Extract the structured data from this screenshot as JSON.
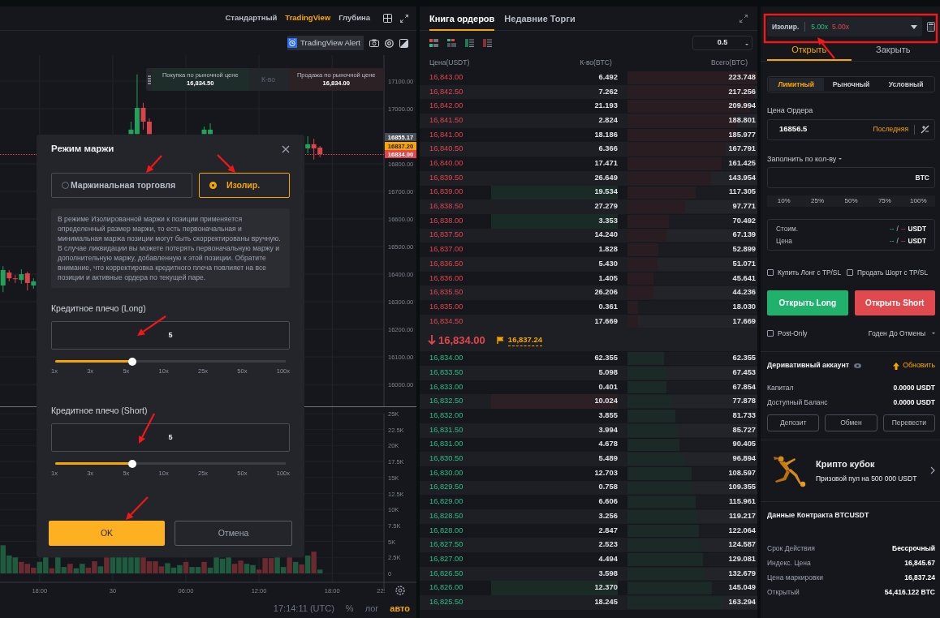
{
  "chart_panel": {
    "view_tabs": [
      {
        "label": "Стандартный",
        "selected": false
      },
      {
        "label": "TradingView",
        "selected": true
      },
      {
        "label": "Глубина",
        "selected": false
      }
    ],
    "alert_button": "TradingView Alert",
    "quick_trade": {
      "buy_label": "Покупка по рыночной цене",
      "buy_price": "16,834.50",
      "qty_label": "К-во",
      "sell_label": "Продажа по рыночной цене",
      "sell_price": "16,834.00"
    },
    "price_pane": {
      "chart_data": {
        "type": "candlestick",
        "categories": [
          null,
          null,
          null,
          null,
          null,
          null,
          null,
          null,
          null,
          null,
          null,
          null,
          null,
          null,
          null,
          null,
          null,
          null,
          null,
          null,
          null,
          null,
          null,
          null,
          null,
          null,
          null,
          null,
          null,
          null,
          null,
          null,
          null,
          null,
          null,
          null,
          null,
          null,
          null,
          null,
          null,
          null,
          null,
          null,
          null,
          null,
          null,
          null,
          null,
          null,
          null,
          null,
          null,
          null,
          null,
          null,
          null,
          null,
          null,
          null,
          null,
          null,
          null
        ],
        "ohlc": [
          [
            16359,
            16429,
            16335,
            16415
          ],
          [
            16406,
            16415,
            16374,
            16385
          ],
          [
            16385,
            16397,
            16368,
            16382
          ],
          [
            16379,
            16418,
            16365,
            16400
          ],
          [
            16403,
            16409,
            16341,
            16368
          ],
          [
            16359,
            16385,
            16347,
            16374
          ],
          null,
          null,
          null,
          null,
          null,
          null,
          null,
          null,
          null,
          null,
          null,
          null,
          null,
          null,
          null,
          [
            16908,
            16953,
            16908,
            16924
          ],
          [
            16908,
            17124,
            16908,
            17003
          ],
          [
            17003,
            17021,
            16924,
            16953
          ],
          [
            16953,
            16965,
            16908,
            16908
          ],
          null,
          null,
          null,
          null,
          null,
          null,
          null,
          null,
          [
            16908,
            16935,
            16908,
            16924
          ],
          [
            16908,
            16947,
            16908,
            16924
          ],
          null,
          null,
          null,
          null,
          null,
          null,
          null,
          null,
          null,
          null,
          null,
          null,
          null,
          null,
          null,
          [
            16856,
            16900,
            16838,
            16871
          ],
          [
            16871,
            16891,
            16815,
            16856
          ],
          [
            16859,
            16865,
            16824,
            16835
          ],
          null,
          null,
          null,
          null,
          null,
          null,
          null,
          null,
          null,
          null
        ],
        "ylim": [
          15921,
          17194
        ],
        "yticks": [
          {
            "value": 17100,
            "label": "17100.00"
          },
          {
            "value": 17000,
            "label": "17000.00"
          },
          {
            "value": 16800,
            "label": "16800.00"
          },
          {
            "value": 16700,
            "label": "16700.00"
          },
          {
            "value": 16600,
            "label": "16600.00"
          },
          {
            "value": 16500,
            "label": "16500.00"
          },
          {
            "value": 16400,
            "label": "16400.00"
          },
          {
            "value": 16300,
            "label": "16300.00"
          },
          {
            "value": 16200,
            "label": "16200.00"
          },
          {
            "value": 16100,
            "label": "16100.00"
          },
          {
            "value": 16000,
            "label": "16000.00"
          }
        ],
        "grid": true
      }
    },
    "price_tags": [
      {
        "text": "16855.17",
        "color": "#474d57"
      },
      {
        "text": "16837.20",
        "color": "#f7a600"
      },
      {
        "text": "16834.00",
        "color": "#e0464c"
      }
    ],
    "volume_pane": {
      "chart_data": {
        "type": "bar",
        "grid": true,
        "categories": [
          null,
          null,
          null,
          null,
          null,
          null,
          "18:00",
          null,
          null,
          null,
          null,
          null,
          null,
          null,
          null,
          null,
          null,
          null,
          "30",
          null,
          null,
          null,
          null,
          null,
          null,
          null,
          null,
          null,
          null,
          null,
          "06:00",
          null,
          null,
          null,
          null,
          null,
          null,
          null,
          null,
          null,
          null,
          null,
          "12:00",
          null,
          null,
          null,
          null,
          null,
          null,
          null,
          null,
          null,
          null,
          null,
          "18:00",
          null,
          null,
          null,
          null,
          null,
          null,
          null,
          null
        ],
        "series": [
          {
            "color": "#1f5c3f",
            "values": [
              4400,
              2800,
              2500,
              null,
              null,
              null,
              1800,
              2500,
              null,
              2500,
              1000,
              null,
              800,
              1500,
              null,
              null,
              1100,
              null,
              2500,
              2500,
              2500,
              2500,
              2500,
              null,
              null,
              null,
              null,
              1600,
              900,
              1300,
              null,
              1000,
              1000,
              null,
              900,
              2500,
              2300,
              2500,
              null,
              null,
              1500,
              1300,
              null,
              null,
              null,
              2500,
              1000,
              null,
              1800,
              null,
              2800,
              null,
              600,
              null,
              null,
              null,
              null,
              null,
              null,
              null,
              null,
              null,
              null
            ]
          },
          {
            "color": "#6a2a2f",
            "values": [
              null,
              null,
              null,
              1800,
              1500,
              900,
              null,
              null,
              800,
              null,
              null,
              1500,
              null,
              null,
              900,
              1900,
              null,
              2500,
              null,
              null,
              null,
              null,
              null,
              2500,
              1900,
              1900,
              1100,
              null,
              null,
              null,
              1800,
              null,
              null,
              1800,
              null,
              null,
              null,
              null,
              1500,
              2000,
              null,
              null,
              600,
              2400,
              2400,
              null,
              null,
              2500,
              null,
              1400,
              null,
              3400,
              null,
              null,
              null,
              null,
              null,
              null,
              null,
              null,
              null,
              null,
              null
            ]
          }
        ],
        "ylim": [
          0,
          25000
        ],
        "yticks": [
          {
            "value": 25000,
            "label": "25K"
          },
          {
            "value": 22500,
            "label": "22.5K"
          },
          {
            "value": 20000,
            "label": "20K"
          },
          {
            "value": 17500,
            "label": "17.5K"
          },
          {
            "value": 15000,
            "label": "15K"
          },
          {
            "value": 12500,
            "label": "12.5K"
          },
          {
            "value": 10000,
            "label": "10K"
          },
          {
            "value": 7500,
            "label": "7.5K"
          },
          {
            "value": 5000,
            "label": "5K"
          },
          {
            "value": 2500,
            "label": "2.5K"
          },
          {
            "value": 0,
            "label": "0"
          }
        ]
      }
    },
    "time_axis_cut_label": "22:",
    "status": {
      "time": "17:14:11 (UTC)",
      "scale_modes": [
        {
          "label": "%",
          "selected": false
        },
        {
          "label": "лог",
          "selected": false
        },
        {
          "label": "авто",
          "selected": true
        }
      ]
    }
  },
  "margin_dialog": {
    "title": "Режим маржи",
    "modes": [
      {
        "label": "Маржинальная торговля",
        "selected": false
      },
      {
        "label": "Изолир.",
        "selected": true
      }
    ],
    "description": "В режиме Изолированной маржи к позиции применяется определенный размер маржи, то есть первоначальная и минимальная маржа позиции могут быть скорректированы вручную. В случае ликвидации вы можете потерять первоначальную маржу и дополнительную маржу, добавленную к этой позиции. Обратите внимание, что корректировка кредитного плеча повлияет на все позиции и активные ордера по текущей паре.",
    "leverage": [
      {
        "label": "Кредитное плечо (Long)",
        "value": "5",
        "level": 0.333,
        "ticks": [
          "1x",
          "3x",
          "5x",
          "10x",
          "25x",
          "50x",
          "100x"
        ]
      },
      {
        "label": "Кредитное плечо (Short)",
        "value": "5",
        "level": 0.333,
        "ticks": [
          "1x",
          "3x",
          "5x",
          "10x",
          "25x",
          "50x",
          "100x"
        ]
      }
    ],
    "buttons": [
      {
        "label": "OK",
        "kind": "primary"
      },
      {
        "label": "Отмена",
        "kind": "secondary"
      }
    ]
  },
  "order_book": {
    "tabs": [
      {
        "label": "Книга ордеров",
        "selected": true
      },
      {
        "label": "Недавние Торги",
        "selected": false
      }
    ],
    "precision": "0.5",
    "columns": [
      "Цена(USDT)",
      "К-во(BTC)",
      "Всего(BTC)"
    ],
    "asks": [
      {
        "price": "16,843.00",
        "qty": "6.492",
        "total": "223.748",
        "level": 1.0
      },
      {
        "price": "16,842.50",
        "qty": "7.262",
        "total": "217.256",
        "level": 0.97
      },
      {
        "price": "16,842.00",
        "qty": "21.193",
        "total": "209.994",
        "level": 0.94
      },
      {
        "price": "16,841.50",
        "qty": "2.824",
        "total": "188.801",
        "level": 0.84
      },
      {
        "price": "16,841.00",
        "qty": "18.186",
        "total": "185.977",
        "level": 0.83
      },
      {
        "price": "16,840.50",
        "qty": "6.366",
        "total": "167.791",
        "level": 0.75
      },
      {
        "price": "16,840.00",
        "qty": "17.471",
        "total": "161.425",
        "level": 0.72
      },
      {
        "price": "16,839.50",
        "qty": "26.649",
        "total": "143.954",
        "level": 0.64
      },
      {
        "price": "16,839.00",
        "qty": "19.534",
        "total": "117.305",
        "level": 0.52,
        "color": "#1a2a25"
      },
      {
        "price": "16,838.50",
        "qty": "27.279",
        "total": "97.771",
        "level": 0.44
      },
      {
        "price": "16,838.00",
        "qty": "3.353",
        "total": "70.492",
        "level": 0.32,
        "color": "#1a2a25"
      },
      {
        "price": "16,837.50",
        "qty": "14.240",
        "total": "67.139",
        "level": 0.3
      },
      {
        "price": "16,837.00",
        "qty": "1.828",
        "total": "52.899",
        "level": 0.24
      },
      {
        "price": "16,836.50",
        "qty": "5.430",
        "total": "51.071",
        "level": 0.23
      },
      {
        "price": "16,836.00",
        "qty": "1.405",
        "total": "45.641",
        "level": 0.2
      },
      {
        "price": "16,835.50",
        "qty": "26.206",
        "total": "44.236",
        "level": 0.2
      },
      {
        "price": "16,835.00",
        "qty": "0.361",
        "total": "18.030",
        "level": 0.08
      },
      {
        "price": "16,834.50",
        "qty": "17.669",
        "total": "17.669",
        "level": 0.08
      }
    ],
    "last_price": {
      "text": "16,834.00",
      "rising": false
    },
    "mark_price": "16,837.24",
    "bids": [
      {
        "price": "16,834.00",
        "qty": "62.355",
        "total": "62.355",
        "level": 0.28
      },
      {
        "price": "16,833.50",
        "qty": "5.098",
        "total": "67.453",
        "level": 0.3
      },
      {
        "price": "16,833.00",
        "qty": "0.401",
        "total": "67.854",
        "level": 0.3
      },
      {
        "price": "16,832.50",
        "qty": "10.024",
        "total": "77.878",
        "level": 0.35,
        "color": "#2c2024"
      },
      {
        "price": "16,832.00",
        "qty": "3.855",
        "total": "81.733",
        "level": 0.37
      },
      {
        "price": "16,831.50",
        "qty": "3.994",
        "total": "85.727",
        "level": 0.38
      },
      {
        "price": "16,831.00",
        "qty": "4.678",
        "total": "90.405",
        "level": 0.4
      },
      {
        "price": "16,830.50",
        "qty": "5.489",
        "total": "96.894",
        "level": 0.43
      },
      {
        "price": "16,830.00",
        "qty": "12.703",
        "total": "108.597",
        "level": 0.49
      },
      {
        "price": "16,829.50",
        "qty": "0.758",
        "total": "109.355",
        "level": 0.49
      },
      {
        "price": "16,829.00",
        "qty": "6.606",
        "total": "115.961",
        "level": 0.52
      },
      {
        "price": "16,828.50",
        "qty": "3.256",
        "total": "119.217",
        "level": 0.53
      },
      {
        "price": "16,828.00",
        "qty": "2.847",
        "total": "122.064",
        "level": 0.55
      },
      {
        "price": "16,827.50",
        "qty": "2.523",
        "total": "124.587",
        "level": 0.56
      },
      {
        "price": "16,827.00",
        "qty": "4.494",
        "total": "129.081",
        "level": 0.58
      },
      {
        "price": "16,826.50",
        "qty": "3.598",
        "total": "132.679",
        "level": 0.59
      },
      {
        "price": "16,826.00",
        "qty": "12.370",
        "total": "145.049",
        "level": 0.65,
        "color": "#1a2a25"
      },
      {
        "price": "16,825.50",
        "qty": "18.245",
        "total": "163.294",
        "level": 0.73
      }
    ]
  },
  "trade_panel": {
    "margin_mode": {
      "label": "Изолир.",
      "long_leverage": "5.00x",
      "short_leverage": "5.00x"
    },
    "tabs": [
      {
        "label": "Открыть",
        "selected": true
      },
      {
        "label": "Закрыть",
        "selected": false
      }
    ],
    "order_types": [
      {
        "label": "Лимитный",
        "selected": true
      },
      {
        "label": "Рыночный",
        "selected": false
      },
      {
        "label": "Условный",
        "selected": false
      }
    ],
    "price_field": {
      "label": "Цена Ордера",
      "value": "16856.5",
      "suffix": "Последняя"
    },
    "qty_field": {
      "label": "Заполнить по кол-ву",
      "suffix": "BTC"
    },
    "percents": [
      "10%",
      "25%",
      "50%",
      "75%",
      "100%"
    ],
    "summary": [
      {
        "label": "Стоим.",
        "buy": "--",
        "separator": "/",
        "sell": "--",
        "unit": "USDT"
      },
      {
        "label": "Цена",
        "buy": "--",
        "separator": "/",
        "sell": "--",
        "unit": "USDT"
      }
    ],
    "tpsl_options": [
      {
        "label": "Купить Лонг с TP/SL",
        "checked": false
      },
      {
        "label": "Продать Шорт с TP/SL",
        "checked": false
      }
    ],
    "actions": [
      {
        "label": "Открыть Long",
        "kind": "long"
      },
      {
        "label": "Открыть Short",
        "kind": "short"
      }
    ],
    "post_only": {
      "label": "Post-Only",
      "checked": false
    },
    "time_in_force": "Годен До Отмены"
  },
  "account": {
    "title": "Деривативный аккаунт",
    "refresh": "Обновить",
    "rows": [
      {
        "label": "Капитал",
        "value": "0.0000 USDT"
      },
      {
        "label": "Доступный Баланс",
        "value": "0.0000 USDT"
      }
    ],
    "buttons": [
      "Депозит",
      "Обмен",
      "Перевести"
    ]
  },
  "promo": {
    "title": "Крипто кубок",
    "subtitle": "Призовой пул на 500 000 USDT"
  },
  "contract": {
    "title": "Данные Контракта BTCUSDT",
    "rows": [
      {
        "label": "Срок Действия",
        "value": "Бессрочный"
      },
      {
        "label": "Индекс. Цена",
        "value": "16,845.67"
      },
      {
        "label": "Цена маркировки",
        "value": "16,837.24"
      },
      {
        "label": "Открытый",
        "value": "54,416.122 BTC"
      }
    ]
  }
}
